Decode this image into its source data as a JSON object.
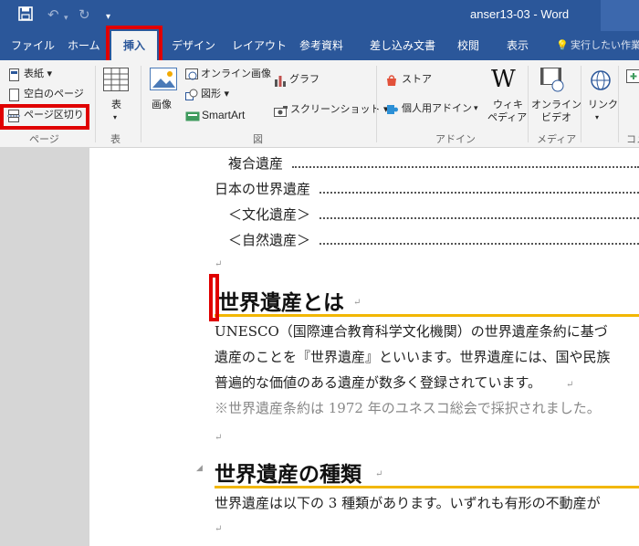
{
  "window": {
    "title": "anser13-03 - Word"
  },
  "tabs": [
    {
      "label": "ファイル"
    },
    {
      "label": "ホーム"
    },
    {
      "label": "挿入"
    },
    {
      "label": "デザイン"
    },
    {
      "label": "レイアウト"
    },
    {
      "label": "参考資料"
    },
    {
      "label": "差し込み文書"
    },
    {
      "label": "校閲"
    },
    {
      "label": "表示"
    },
    {
      "label": "実行したい作業"
    }
  ],
  "ribbon": {
    "page_group": {
      "items": [
        "表紙",
        "空白のページ",
        "ページ区切り"
      ],
      "name": "ページ"
    },
    "table_group": {
      "button": "表",
      "name": "表"
    },
    "illust_group": {
      "image": "画像",
      "online_image": "オンライン画像",
      "shapes": "図形",
      "smartart": "SmartArt",
      "chart": "グラフ",
      "screenshot": "スクリーンショット",
      "name": "図"
    },
    "addin_group": {
      "store": "ストア",
      "personal": "個人用アドイン",
      "wiki_line1": "ウィキ",
      "wiki_line2": "ペディア",
      "name": "アドイン"
    },
    "media_group": {
      "line1": "オンライン",
      "line2": "ビデオ",
      "name": "メディア"
    },
    "link_group": {
      "label": "リンク"
    },
    "comment_group": {
      "name": "コメ"
    }
  },
  "document": {
    "toc": [
      "複合遺産",
      "日本の世界遺産",
      "＜文化遺産＞",
      "＜自然遺産＞"
    ],
    "heading1": "世界遺産とは",
    "para1": [
      "UNESCO（国際連合教育科学文化機関）の世界遺産条約に基づ",
      "遺産のことを『世界遺産』といいます。世界遺産には、国や民族",
      "普遍的な価値のある遺産が数多く登録されています。"
    ],
    "note": "※世界遺産条約は 1972 年のユネスコ総会で採択されました。",
    "heading2": "世界遺産の種類",
    "para2": "世界遺産は以下の 3 種類があります。いずれも有形の不動産が"
  },
  "colors": {
    "titlebar": "#2b579a",
    "ribbon": "#f3f3f3",
    "highlight": "#e00000",
    "heading_rule": "#f2b701"
  }
}
